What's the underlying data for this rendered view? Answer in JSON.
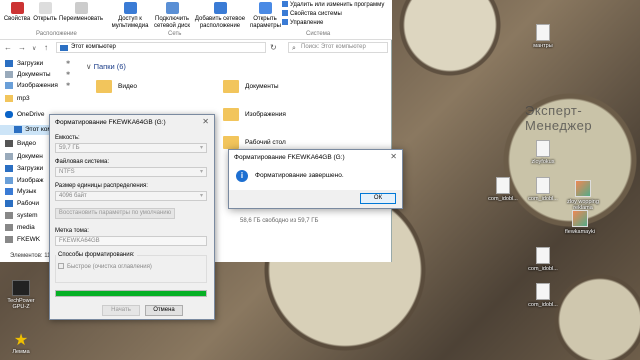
{
  "ribbon": {
    "buttons": [
      "Свойства",
      "Открыть",
      "Переименовать",
      "Доступ к мультимедиа",
      "Подключить сетевой диск",
      "Добавить сетевое расположение",
      "Открыть параметры"
    ],
    "system_items": [
      "Удалить или изменить программу",
      "Свойства системы",
      "Управление"
    ],
    "groups": [
      "Расположение",
      "Сеть",
      "Система"
    ]
  },
  "address": {
    "path": "Этот компьютер",
    "search_placeholder": "Поиск: Этот компьютер"
  },
  "sidebar": {
    "items": [
      "Загрузки",
      "Документы",
      "Изображения",
      "mp3",
      "OneDrive",
      "Этот комп",
      "Видео",
      "Докумен",
      "Загрузки",
      "Изображ",
      "Музык",
      "Рабочи",
      "system",
      "media",
      "FKEWK"
    ]
  },
  "content": {
    "section": "Папки (6)",
    "folders": [
      "Видео",
      "Документы",
      "Изображения",
      "Рабочий стол"
    ],
    "drive_info": "58,6 ГБ свободно из 59,7 ГБ",
    "drive_used_fraction": 0.02
  },
  "statusbar": "Элементов: 11",
  "format_dialog": {
    "title": "Форматирование FKEWKA64GB (G:)",
    "capacity_label": "Емкость:",
    "capacity_value": "59,7 ГБ",
    "fs_label": "Файловая система:",
    "fs_value": "NTFS",
    "cluster_label": "Размер единицы распределения:",
    "cluster_value": "4096 байт",
    "restore_button": "Восстановить параметры по умолчанию",
    "volume_label": "Метка тома:",
    "volume_value": "FKEWKA64GB",
    "methods_label": "Способы форматирования:",
    "quick_label": "Быстрое (очистка оглавления)",
    "progress": 1.0,
    "start_button": "Начать",
    "cancel_button": "Отмена"
  },
  "message_box": {
    "title": "Форматирование FKEWKA64GB (G:)",
    "text": "Форматирование завершено.",
    "ok_button": "ОК"
  },
  "desktop_icons": [
    "мантры",
    "zloyfokus",
    "com_idobl...",
    "com_idobl...",
    "com_idobl...",
    "com_idobl...",
    "zloy wopping reklama",
    "flewkamayki"
  ],
  "watermark": "Эксперт-Менеджер",
  "left_icons": [
    "TechPower GPU-Z",
    "Лемма"
  ]
}
